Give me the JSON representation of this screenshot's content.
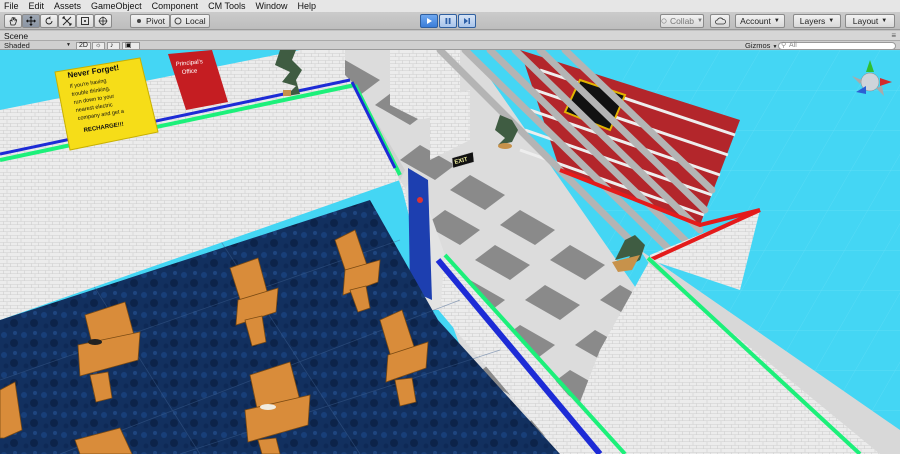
{
  "menu": [
    "File",
    "Edit",
    "Assets",
    "GameObject",
    "Component",
    "CM Tools",
    "Window",
    "Help"
  ],
  "toolbar": {
    "pivot_label": "Pivot",
    "local_label": "Local",
    "collab_label": "Collab",
    "account_label": "Account",
    "layers_label": "Layers",
    "layout_label": "Layout"
  },
  "scene": {
    "tab_label": "Scene",
    "shading_mode": "Shaded",
    "mode_2d": "2D",
    "gizmos_label": "Gizmos",
    "search_placeholder": "All"
  },
  "signs": {
    "poster_title": "Never Forget!",
    "poster_lines": [
      "If you're having",
      "trouble thinking,",
      "run down to your",
      "nearest electric",
      "company and get a",
      "RECHARGE!!!"
    ],
    "office_line1": "Principal's",
    "office_line2": "Office",
    "exit_sign": "EXIT"
  },
  "colors": {
    "sky": "#44d6f4",
    "floor_light": "#e4e4e4",
    "floor_dark": "#7d7d7d",
    "wall": "#e9e9e9",
    "carpet": "#0e2b5c",
    "desk": "#d98c3a",
    "green_trim": "#1cf07a",
    "blue_trim": "#1d2bd6",
    "red_trim": "#e41b1b",
    "play_blue": "#3b7dd8"
  }
}
